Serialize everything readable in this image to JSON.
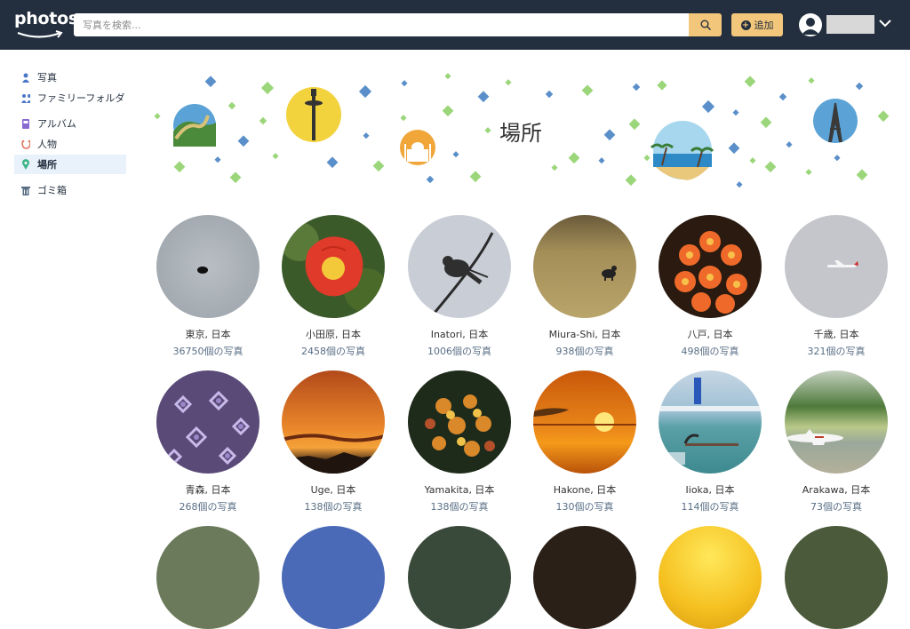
{
  "header": {
    "logo": "photos",
    "search_placeholder": "写真を検索...",
    "add_label": "追加"
  },
  "sidebar": {
    "items": [
      {
        "label": "写真",
        "icon": "person-icon",
        "color": "#4a78c8"
      },
      {
        "label": "ファミリーフォルダ",
        "icon": "family-icon",
        "color": "#4a78c8"
      },
      {
        "label": "アルバム",
        "icon": "album-icon",
        "color": "#8a6ad0"
      },
      {
        "label": "人物",
        "icon": "face-icon",
        "color": "#e07a5f"
      },
      {
        "label": "場所",
        "icon": "pin-icon",
        "color": "#3eb489"
      },
      {
        "label": "ゴミ箱",
        "icon": "trash-icon",
        "color": "#5a6f86"
      }
    ],
    "active": "場所"
  },
  "page": {
    "title": "場所"
  },
  "places": [
    {
      "name": "東京, 日本",
      "count": "36750個の写真"
    },
    {
      "name": "小田原, 日本",
      "count": "2458個の写真"
    },
    {
      "name": "Inatori, 日本",
      "count": "1006個の写真"
    },
    {
      "name": "Miura-Shi, 日本",
      "count": "938個の写真"
    },
    {
      "name": "八戸, 日本",
      "count": "498個の写真"
    },
    {
      "name": "千歳, 日本",
      "count": "321個の写真"
    },
    {
      "name": "青森, 日本",
      "count": "268個の写真"
    },
    {
      "name": "Uge, 日本",
      "count": "138個の写真"
    },
    {
      "name": "Yamakita, 日本",
      "count": "138個の写真"
    },
    {
      "name": "Hakone, 日本",
      "count": "130個の写真"
    },
    {
      "name": "Iioka, 日本",
      "count": "114個の写真"
    },
    {
      "name": "Arakawa, 日本",
      "count": "73個の写真"
    }
  ],
  "colors": {
    "header_bg": "#232f3e",
    "accent": "#f3c77b",
    "active_nav_bg": "#e9f1fa"
  }
}
